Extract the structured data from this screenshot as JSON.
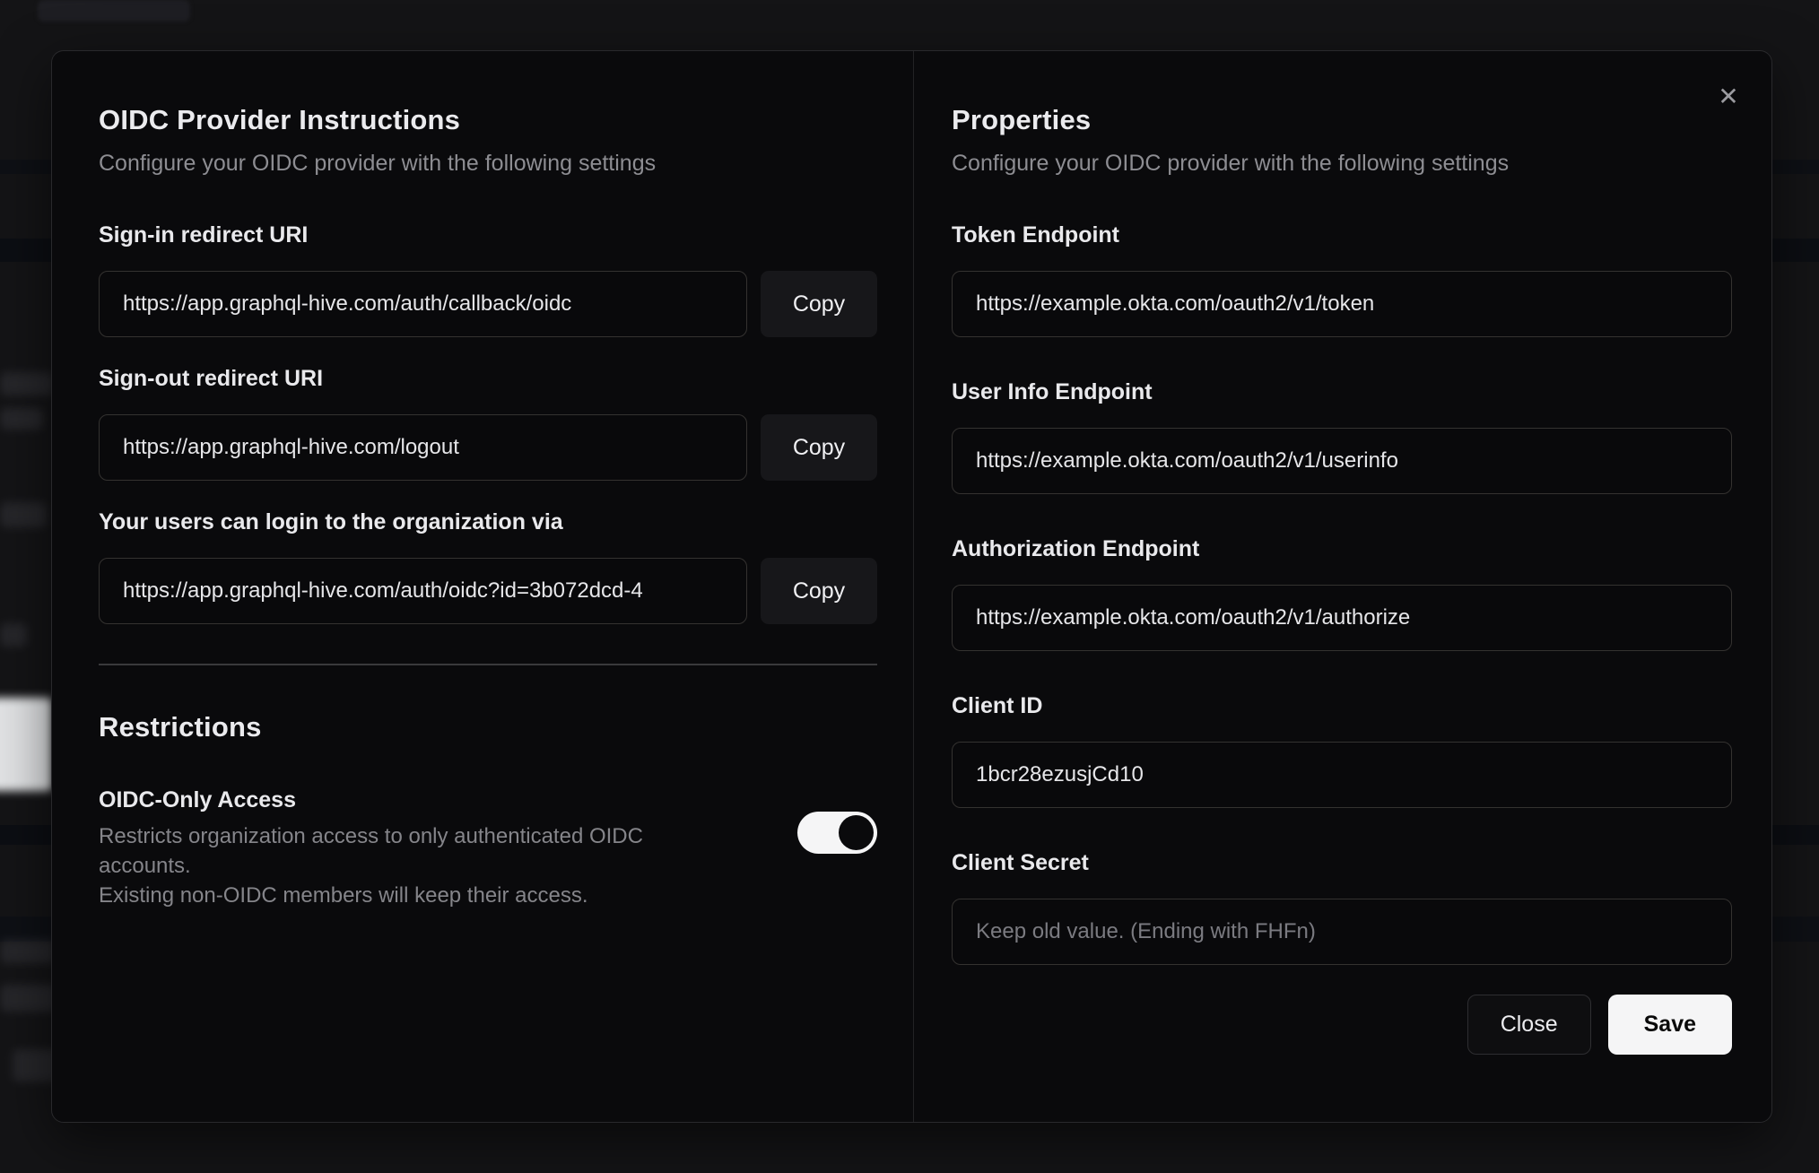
{
  "modal": {
    "close_icon": "✕",
    "left": {
      "title": "OIDC Provider Instructions",
      "subtitle": "Configure your OIDC provider with the following settings",
      "fields": [
        {
          "label": "Sign-in redirect URI",
          "value": "https://app.graphql-hive.com/auth/callback/oidc",
          "button": "Copy"
        },
        {
          "label": "Sign-out redirect URI",
          "value": "https://app.graphql-hive.com/logout",
          "button": "Copy"
        },
        {
          "label": "Your users can login to the organization via",
          "value": "https://app.graphql-hive.com/auth/oidc?id=3b072dcd-4",
          "button": "Copy"
        }
      ],
      "restrictions": {
        "title": "Restrictions",
        "toggle_label": "OIDC-Only Access",
        "description_line1": "Restricts organization access to only authenticated OIDC accounts.",
        "description_line2": "Existing non-OIDC members will keep their access.",
        "toggle_state": "on"
      }
    },
    "right": {
      "title": "Properties",
      "subtitle": "Configure your OIDC provider with the following settings",
      "fields": [
        {
          "label": "Token Endpoint",
          "value": "https://example.okta.com/oauth2/v1/token"
        },
        {
          "label": "User Info Endpoint",
          "value": "https://example.okta.com/oauth2/v1/userinfo"
        },
        {
          "label": "Authorization Endpoint",
          "value": "https://example.okta.com/oauth2/v1/authorize"
        },
        {
          "label": "Client ID",
          "value": "1bcr28ezusjCd10"
        },
        {
          "label": "Client Secret",
          "value": "",
          "placeholder": "Keep old value. (Ending with FHFn)"
        }
      ],
      "buttons": {
        "close": "Close",
        "save": "Save"
      }
    },
    "colors": {
      "modal_bg": "#0a0a0c",
      "page_bg": "#141416",
      "input_border": "#343230",
      "save_bg": "#f5f5f6",
      "toggle_on_track": "#f5f5f6",
      "heading_text": "#ebebee",
      "muted_text": "#8d8d92"
    }
  }
}
